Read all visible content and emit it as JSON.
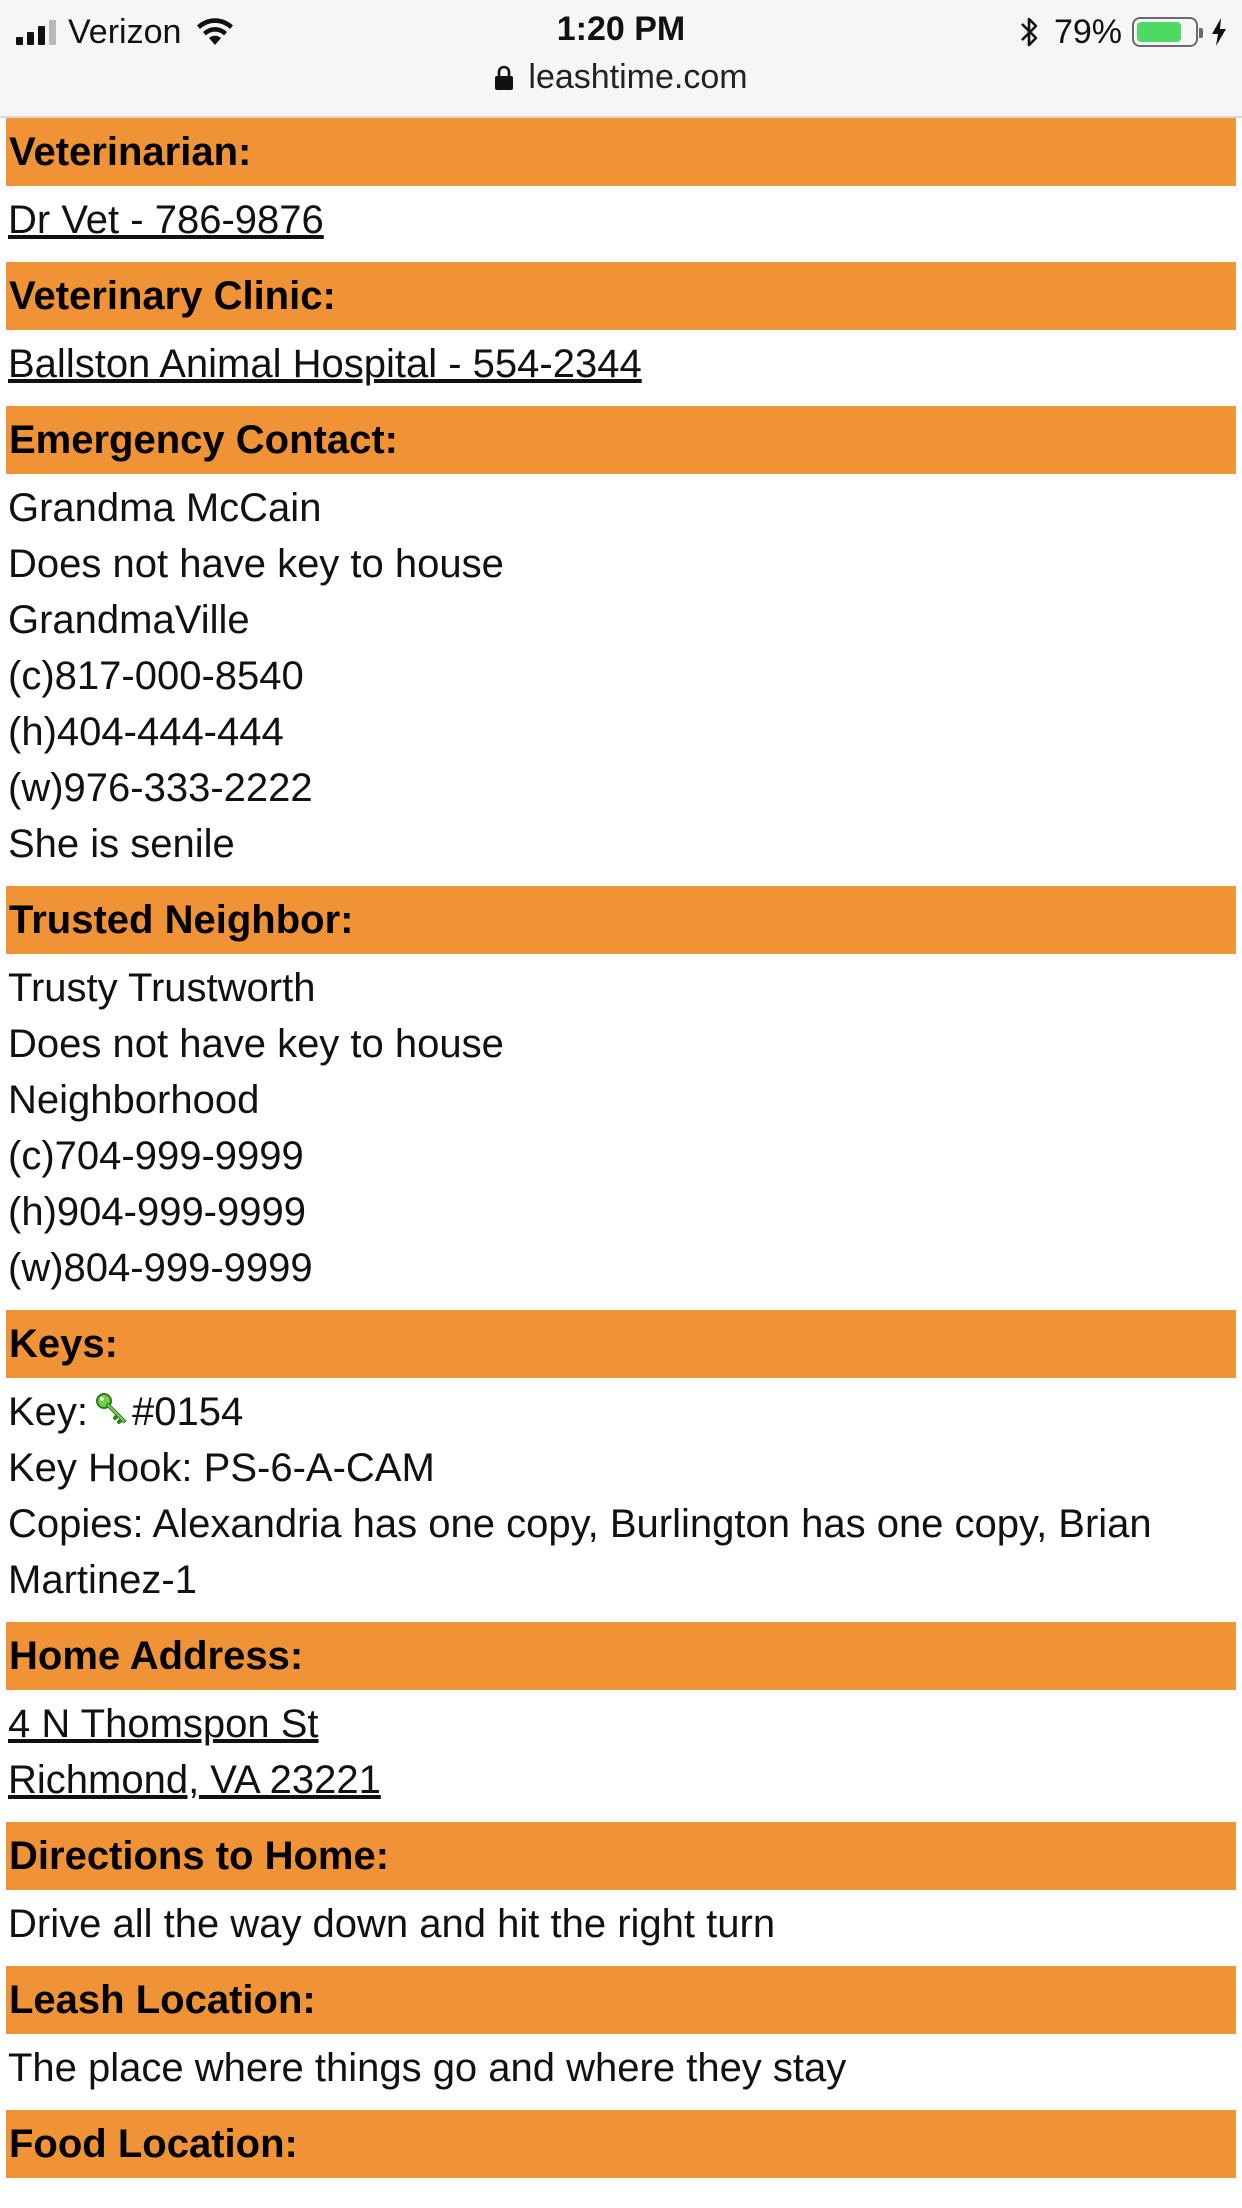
{
  "status_bar": {
    "carrier": "Verizon",
    "time": "1:20 PM",
    "battery_percent": "79%",
    "battery_level": 0.79,
    "url": "leashtime.com",
    "icons": [
      "signal-icon",
      "wifi-icon",
      "bluetooth-icon",
      "battery-icon",
      "charging-icon",
      "lock-icon"
    ]
  },
  "colors": {
    "header_background": "#f09236",
    "battery_fill": "#4cd964",
    "key_icon": "#6fd04a"
  },
  "sections": {
    "veterinarian": {
      "title": "Veterinarian:",
      "link": "Dr Vet - 786-9876"
    },
    "clinic": {
      "title": "Veterinary Clinic:",
      "link": "Ballston Animal Hospital - 554-2344"
    },
    "emergency": {
      "title": "Emergency Contact:",
      "lines": [
        "Grandma McCain",
        "Does not have key to house",
        "GrandmaVille",
        "(c)817-000-8540",
        "(h)404-444-444",
        "(w)976-333-2222",
        "She is senile"
      ]
    },
    "neighbor": {
      "title": "Trusted Neighbor:",
      "lines": [
        "Trusty Trustworth",
        "Does not have key to house",
        "Neighborhood",
        "(c)704-999-9999",
        "(h)904-999-9999",
        "(w)804-999-9999"
      ]
    },
    "keys": {
      "title": "Keys:",
      "key_label": "Key:",
      "key_number": "#0154",
      "key_hook": "Key Hook: PS-6-A-CAM",
      "copies": "Copies: Alexandria has one copy, Burlington has one copy, Brian Martinez-1"
    },
    "home_address": {
      "title": "Home Address:",
      "line1": "4 N Thomspon St",
      "line2": "Richmond, VA 23221"
    },
    "directions": {
      "title": "Directions to Home:",
      "text": "Drive all the way down and hit the right turn"
    },
    "leash": {
      "title": "Leash Location:",
      "text": "The place where things go and where they stay"
    },
    "food": {
      "title": "Food Location:"
    }
  }
}
